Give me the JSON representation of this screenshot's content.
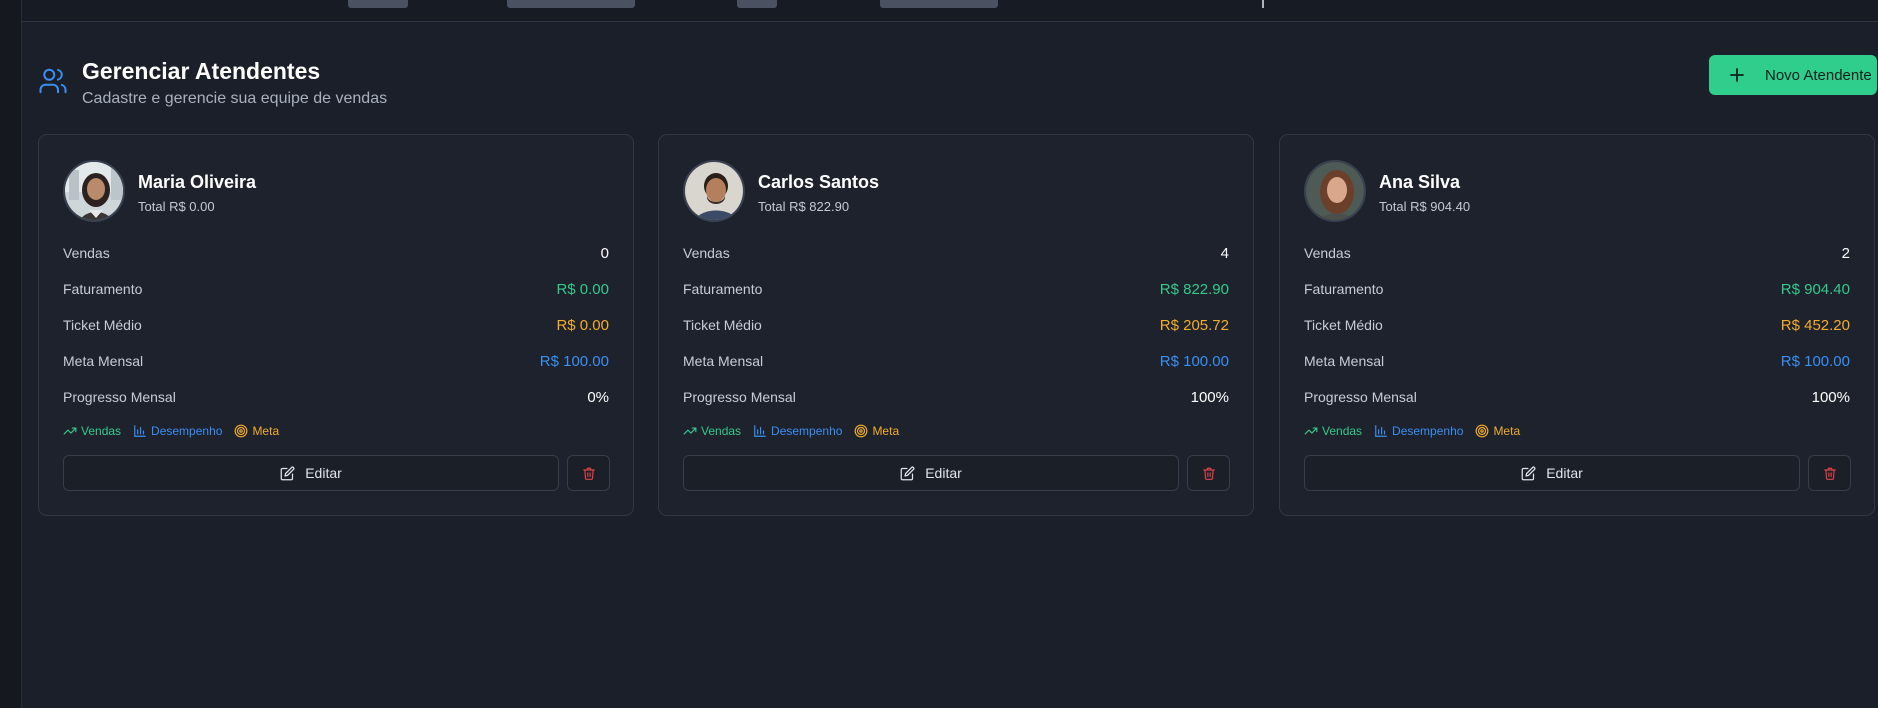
{
  "header": {
    "title": "Gerenciar Atendentes",
    "subtitle": "Cadastre e gerencie sua equipe de vendas",
    "new_button_label": "Novo Atendente"
  },
  "colors": {
    "accent_green": "#2fce8c",
    "value_green": "#35c98a",
    "value_orange": "#f2ad2c",
    "value_blue": "#3a8ff2",
    "danger_red": "#e0424a",
    "background": "#1b1f29",
    "card": "#1d222d"
  },
  "labels": {
    "vendas": "Vendas",
    "faturamento": "Faturamento",
    "ticket": "Ticket Médio",
    "meta": "Meta Mensal",
    "progresso": "Progresso Mensal",
    "tag_vendas": "Vendas",
    "tag_desempenho": "Desempenho",
    "tag_meta": "Meta",
    "edit": "Editar"
  },
  "attendants": [
    {
      "name": "Maria Oliveira",
      "total": "Total R$ 0.00",
      "vendas": "0",
      "faturamento": "R$ 0.00",
      "ticket": "R$ 0.00",
      "meta": "R$ 100.00",
      "progresso": "0%"
    },
    {
      "name": "Carlos Santos",
      "total": "Total R$ 822.90",
      "vendas": "4",
      "faturamento": "R$ 822.90",
      "ticket": "R$ 205.72",
      "meta": "R$ 100.00",
      "progresso": "100%"
    },
    {
      "name": "Ana Silva",
      "total": "Total R$ 904.40",
      "vendas": "2",
      "faturamento": "R$ 904.40",
      "ticket": "R$ 452.20",
      "meta": "R$ 100.00",
      "progresso": "100%"
    }
  ],
  "icons": {
    "header": "users-icon",
    "new": "plus-icon",
    "tag_vendas": "trending-up-icon",
    "tag_desempenho": "bar-chart-icon",
    "tag_meta": "target-icon",
    "edit": "edit-icon",
    "delete": "trash-icon"
  }
}
